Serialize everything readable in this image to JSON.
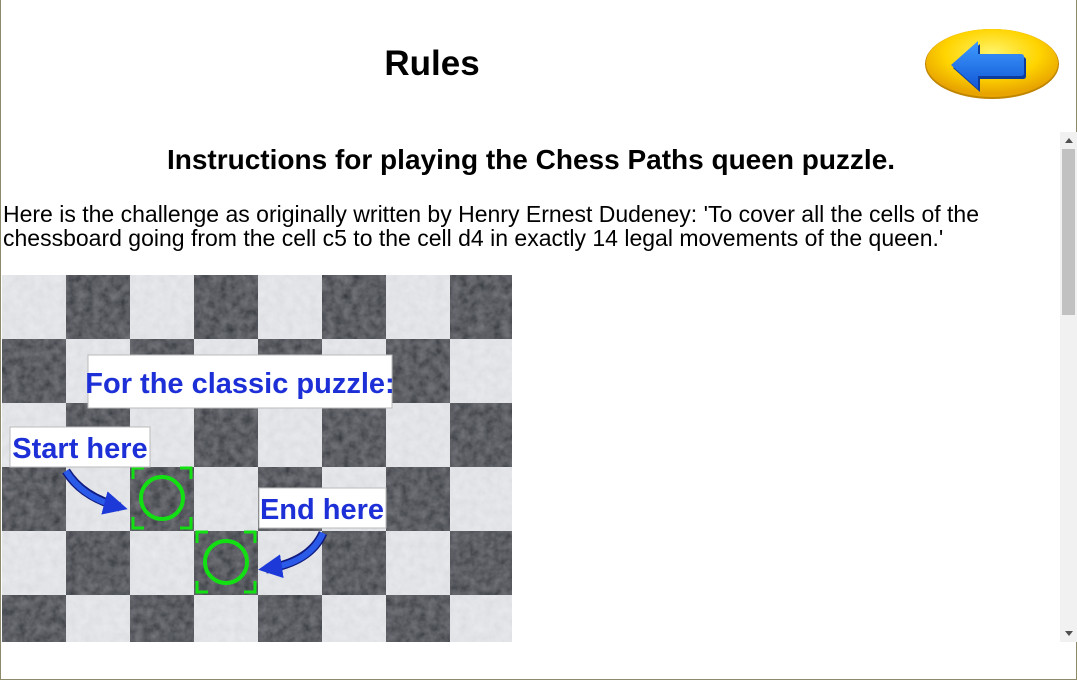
{
  "header": {
    "title": "Rules"
  },
  "back_button": {
    "icon": "arrow-left-icon",
    "colors": {
      "button": "#ffd700",
      "arrow": "#1e6ff0"
    }
  },
  "content": {
    "heading": "Instructions for playing the Chess Paths queen puzzle.",
    "paragraph": "Here is the challenge as originally written by Henry Ernest Dudeney: 'To cover all the cells of the chessboard going from the cell c5 to the cell d4 in exactly 14 legal movements of the queen.'",
    "image": {
      "label_classic": "For the classic puzzle:",
      "label_start": "Start here",
      "label_end": "End here",
      "colors": {
        "label_text": "#1d2fd6",
        "marker": "#13e013",
        "arrow": "#1d3ad8",
        "dark_square": "#2b3137",
        "light_square": "#e9ebee"
      }
    }
  },
  "scrollbar": {
    "up_icon": "triangle-up-icon",
    "down_icon": "triangle-down-icon"
  }
}
